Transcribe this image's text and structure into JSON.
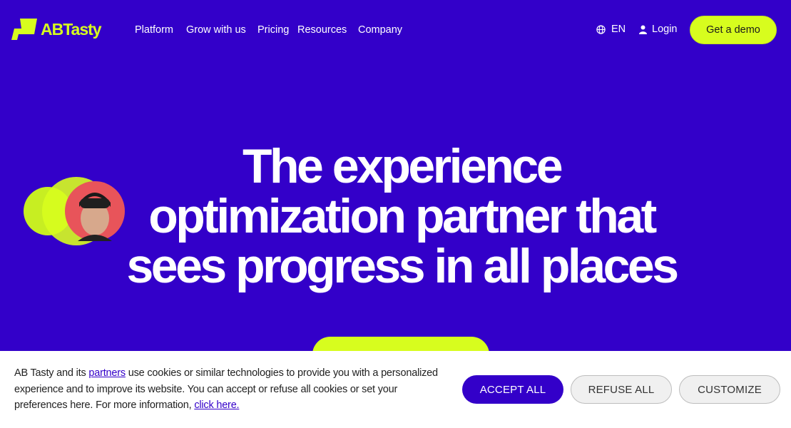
{
  "brand": {
    "name": "ABTasty",
    "accent": "#d7fd1e",
    "background": "#3300c9"
  },
  "nav": {
    "links": [
      "Platform",
      "Grow with us",
      "Pricing",
      "Resources",
      "Company"
    ],
    "language": "EN",
    "login": "Login",
    "demo_button": "Get a demo"
  },
  "hero": {
    "title_lines": [
      "The experience",
      "optimization partner that",
      "sees progress in all places"
    ]
  },
  "cookie": {
    "text_before_link": "AB Tasty and its ",
    "partners_link": "partners",
    "text_after_link": " use cookies or similar technologies to provide you with a personalized experience and to improve its website. You can accept or refuse all cookies or set your preferences here. For more information, ",
    "more_info_link": "click here.",
    "accept": "ACCEPT ALL",
    "refuse": "REFUSE ALL",
    "customize": "CUSTOMIZE"
  },
  "icons": {
    "language": "globe-icon",
    "login": "user-icon"
  }
}
